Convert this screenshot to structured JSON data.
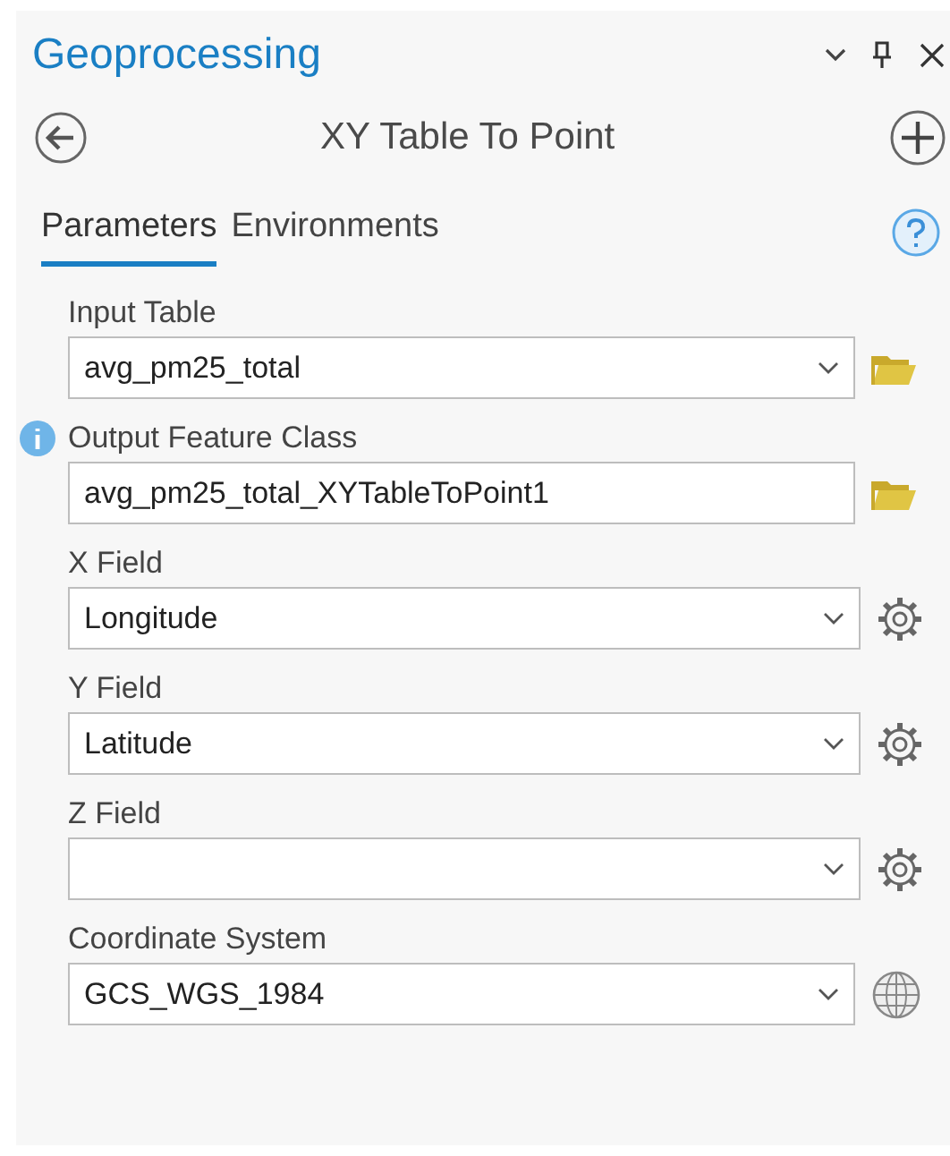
{
  "pane": {
    "title": "Geoprocessing",
    "tool_title": "XY Table To Point"
  },
  "tabs": [
    {
      "label": "Parameters",
      "selected": true
    },
    {
      "label": "Environments",
      "selected": false
    }
  ],
  "parameters": [
    {
      "label": "Input Table",
      "value": "avg_pm25_total",
      "dropdown": true,
      "info": false,
      "kind": "folder"
    },
    {
      "label": "Output Feature Class",
      "value": "avg_pm25_total_XYTableToPoint1",
      "dropdown": false,
      "info": true,
      "kind": "folder"
    },
    {
      "label": "X Field",
      "value": "Longitude",
      "dropdown": true,
      "info": false,
      "kind": "gear"
    },
    {
      "label": "Y Field",
      "value": "Latitude",
      "dropdown": true,
      "info": false,
      "kind": "gear"
    },
    {
      "label": "Z Field",
      "dropdown": true,
      "info": false,
      "kind": "gear"
    },
    {
      "label": "Coordinate System",
      "value": "GCS_WGS_1984",
      "dropdown": true,
      "info": false,
      "kind": "globe"
    }
  ]
}
